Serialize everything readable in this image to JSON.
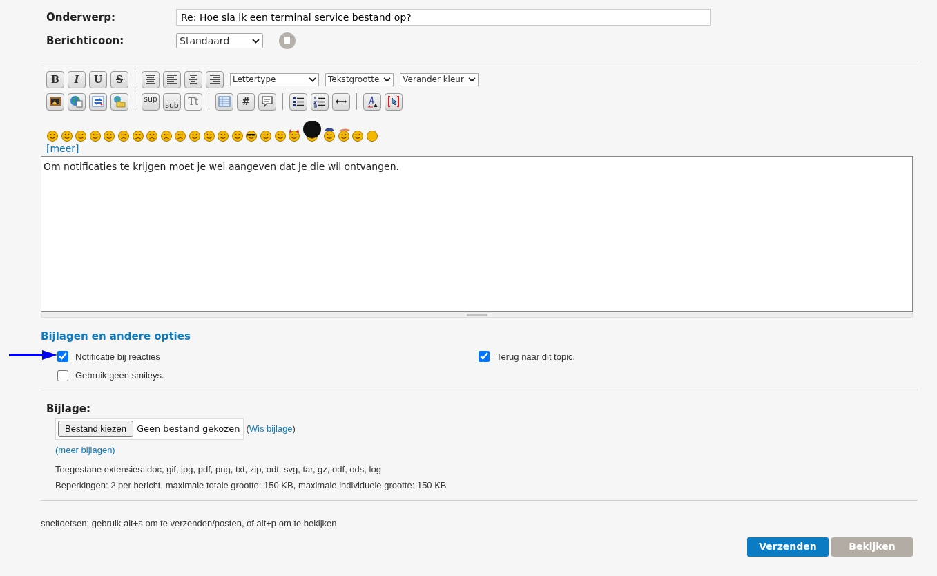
{
  "fields": [
    {
      "label": "Onderwerp:",
      "kind": "text",
      "value": "Re: Hoe sla ik een terminal service bestand op?"
    },
    {
      "label": "Berichticoon:",
      "kind": "select",
      "value": "Standaard"
    }
  ],
  "toolbar": [
    [
      {
        "kind": "text",
        "label": "B"
      },
      {
        "kind": "text",
        "label": "I"
      },
      {
        "kind": "text",
        "label": "U"
      },
      {
        "kind": "text",
        "label": "S"
      },
      {
        "kind": "sep"
      },
      {
        "kind": "icon"
      },
      {
        "kind": "icon"
      },
      {
        "kind": "icon"
      },
      {
        "kind": "icon"
      },
      {
        "kind": "select",
        "value": "Lettertype"
      },
      {
        "kind": "select",
        "value": "Tekstgrootte"
      },
      {
        "kind": "select",
        "value": "Verander kleur"
      }
    ],
    [
      {
        "kind": "icon"
      },
      {
        "kind": "icon"
      },
      {
        "kind": "icon"
      },
      {
        "kind": "icon"
      },
      {
        "kind": "sep"
      },
      {
        "kind": "text",
        "label": "sup"
      },
      {
        "kind": "text",
        "label": "sub"
      },
      {
        "kind": "text",
        "label": "Tt"
      },
      {
        "kind": "sep"
      },
      {
        "kind": "icon"
      },
      {
        "kind": "text",
        "label": "#"
      },
      {
        "kind": "icon"
      },
      {
        "kind": "sep"
      },
      {
        "kind": "icon"
      },
      {
        "kind": "icon"
      },
      {
        "kind": "icon"
      },
      {
        "kind": "sep"
      },
      {
        "kind": "icon"
      },
      {
        "kind": "icon"
      }
    ]
  ],
  "smileys": [
    {
      "kind": "plain"
    },
    {
      "kind": "plain"
    },
    {
      "kind": "plain"
    },
    {
      "kind": "plain"
    },
    {
      "kind": "plain"
    },
    {
      "kind": "sad"
    },
    {
      "kind": "sad"
    },
    {
      "kind": "sad"
    },
    {
      "kind": "sad"
    },
    {
      "kind": "sad"
    },
    {
      "kind": "plain"
    },
    {
      "kind": "plain"
    },
    {
      "kind": "plain"
    },
    {
      "kind": "plain"
    },
    {
      "kind": "sunglasses"
    },
    {
      "kind": "plain"
    },
    {
      "kind": "plain"
    },
    {
      "kind": "horns"
    },
    {
      "kind": "afro"
    },
    {
      "kind": "cap"
    },
    {
      "kind": "hat"
    },
    {
      "kind": "plain"
    },
    {
      "kind": "blank"
    }
  ],
  "more_smileys": "[meer]",
  "message": "Om notificaties te krijgen moet je wel aangeven dat je die wil ontvangen.",
  "options_title": "Bijlagen en andere opties",
  "options": [
    {
      "label": "Notificatie bij reacties",
      "checked": true
    },
    {
      "label": "Terug naar dit topic.",
      "checked": true
    },
    {
      "label": "Gebruik geen smileys.",
      "checked": false
    }
  ],
  "attachment": {
    "label": "Bijlage:",
    "choose_button": "Bestand kiezen",
    "no_file": "Geen bestand gekozen",
    "clear_open": "(",
    "clear_link": "Wis bijlage",
    "clear_close": ")",
    "more_link": "(meer bijlagen)",
    "extensions": "Toegestane extensies: doc, gif, jpg, pdf, png, txt, zip, odt, svg, tar, gz, odf, ods, log",
    "limits": "Beperkingen: 2 per bericht, maximale totale grootte: 150 KB, maximale individuele grootte: 150 KB"
  },
  "shortcuts": "sneltoetsen: gebruik alt+s om te verzenden/posten, of alt+p om te bekijken",
  "buttons": [
    {
      "label": "Verzenden",
      "kind": "primary"
    },
    {
      "label": "Bekijken",
      "kind": "secondary"
    }
  ]
}
